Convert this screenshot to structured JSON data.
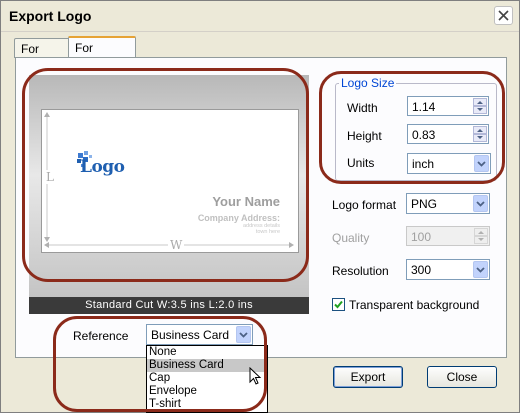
{
  "window": {
    "title": "Export Logo"
  },
  "tabs": [
    {
      "label": "For Web",
      "active": false
    },
    {
      "label": "For Publish",
      "active": true
    }
  ],
  "preview": {
    "logo_text": "Logo",
    "name_text": "Your Name",
    "company_text": "Company Address:",
    "address_line1": "address details",
    "address_line2": "town here",
    "height_marker": "L",
    "width_marker": "W",
    "cut_info": "Standard Cut  W:3.5 ins  L:2.0 ins"
  },
  "logo_size": {
    "title": "Logo Size",
    "width_label": "Width",
    "width_value": "1.14",
    "height_label": "Height",
    "height_value": "0.83",
    "units_label": "Units",
    "units_value": "inch"
  },
  "format": {
    "label": "Logo format",
    "value": "PNG"
  },
  "quality": {
    "label": "Quality",
    "value": "100"
  },
  "resolution": {
    "label": "Resolution",
    "value": "300"
  },
  "transparent": {
    "label": "Transparent background",
    "checked": true
  },
  "reference": {
    "label": "Reference",
    "value": "Business Card",
    "options": [
      "None",
      "Business Card",
      "Cap",
      "Envelope",
      "T-shirt"
    ],
    "highlighted": "Business Card"
  },
  "buttons": {
    "export": "Export",
    "close": "Close"
  },
  "colors": {
    "annotation": "#8b2a1a",
    "group_title": "#0046d5",
    "logo_blue": "#1f5fb0"
  }
}
